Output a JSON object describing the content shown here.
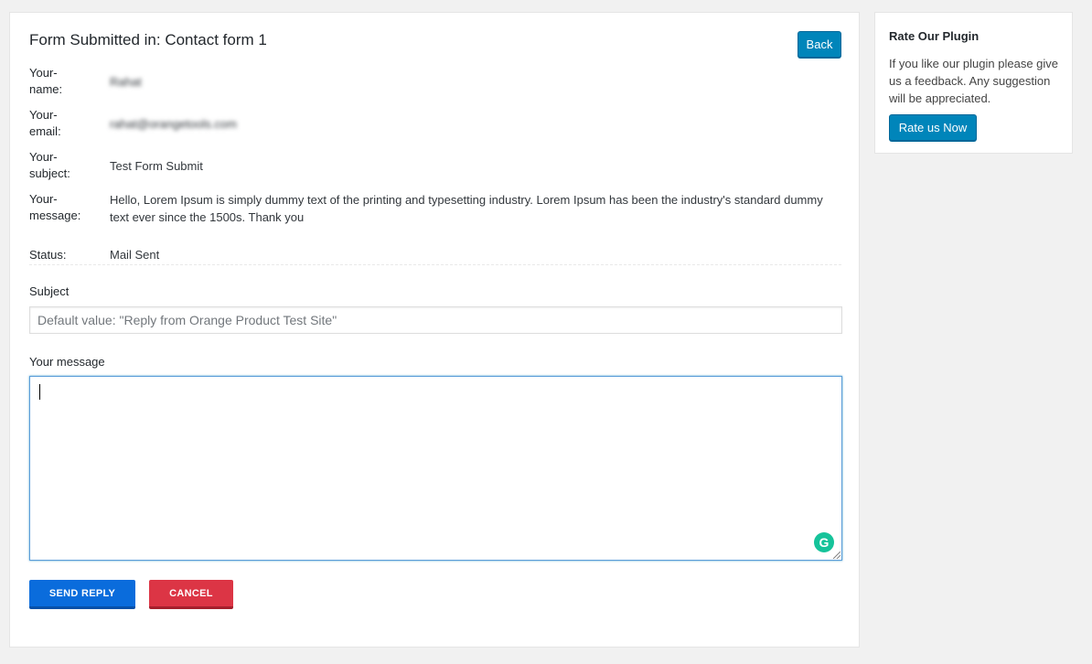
{
  "main": {
    "title": "Form Submitted in: Contact form 1",
    "back_label": "Back",
    "details": [
      {
        "label_line1": "Your-",
        "label_line2": "name:",
        "value": "Rahat"
      },
      {
        "label_line1": "Your-",
        "label_line2": "email:",
        "value": "rahat@orangetools.com"
      },
      {
        "label_line1": "Your-",
        "label_line2": "subject:",
        "value": "Test Form Submit"
      },
      {
        "label_line1": "Your-",
        "label_line2": "message:",
        "value": "Hello, Lorem Ipsum is simply dummy text of the printing and typesetting industry. Lorem Ipsum has been the industry's standard dummy text ever since the 1500s. Thank you"
      },
      {
        "label_line1": "Status:",
        "label_line2": "",
        "value": "Mail Sent"
      }
    ],
    "subject_label": "Subject",
    "subject_placeholder": "Default value: \"Reply from Orange Product Test Site\"",
    "message_label": "Your message",
    "message_value": "",
    "send_label": "SEND REPLY",
    "cancel_label": "CANCEL"
  },
  "sidebar": {
    "title": "Rate Our Plugin",
    "text": "If you like our plugin please give us a feedback. Any suggestion will be appreciated.",
    "button_label": "Rate us Now"
  },
  "colors": {
    "primary_button": "#0085ba",
    "send_button": "#0a6cdc",
    "cancel_button": "#dc3545",
    "background": "#f1f1f1"
  },
  "icons": {
    "grammarly": "grammarly-icon",
    "resize": "resize-handle-icon"
  }
}
